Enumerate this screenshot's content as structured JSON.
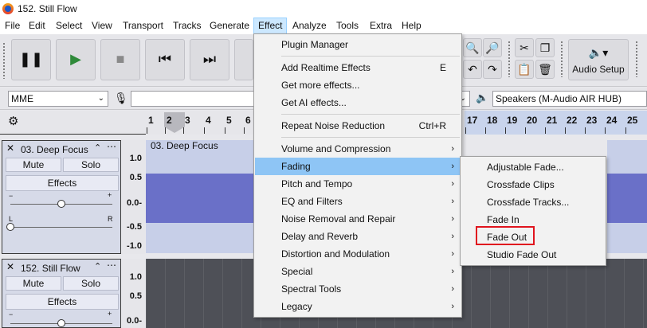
{
  "window": {
    "title": "152. Still Flow"
  },
  "menubar": {
    "items": [
      "File",
      "Edit",
      "Select",
      "View",
      "Transport",
      "Tracks",
      "Generate",
      "Effect",
      "Analyze",
      "Tools",
      "Extra",
      "Help"
    ],
    "open": "Effect"
  },
  "toolbar": {
    "audio_setup_label": "Audio Setup"
  },
  "devices": {
    "host": "MME",
    "output": "Speakers (M-Audio AIR HUB)"
  },
  "timeline": {
    "ticks": [
      "1",
      "2",
      "3",
      "4",
      "5",
      "6",
      "17",
      "18",
      "19",
      "20",
      "21",
      "22",
      "23",
      "24",
      "25"
    ]
  },
  "tracks": [
    {
      "name": "03. Deep Focus",
      "mute": "Mute",
      "solo": "Solo",
      "effects": "Effects",
      "pan_left": "L",
      "pan_right": "R",
      "clip_name": "03. Deep Focus",
      "scale": [
        "1.0",
        "0.5",
        "0.0-",
        "-0.5",
        "-1.0"
      ]
    },
    {
      "name": "152. Still Flow",
      "mute": "Mute",
      "solo": "Solo",
      "effects": "Effects",
      "scale": [
        "1.0",
        "0.5",
        "0.0-"
      ]
    }
  ],
  "effect_menu": {
    "items": [
      {
        "label": "Plugin Manager"
      },
      {
        "label": "Add Realtime Effects",
        "shortcut": "E"
      },
      {
        "label": "Get more effects..."
      },
      {
        "label": "Get AI effects..."
      },
      {
        "label": "Repeat Noise Reduction",
        "shortcut": "Ctrl+R"
      },
      {
        "label": "Volume and Compression",
        "submenu": true
      },
      {
        "label": "Fading",
        "submenu": true,
        "highlighted": true
      },
      {
        "label": "Pitch and Tempo",
        "submenu": true
      },
      {
        "label": "EQ and Filters",
        "submenu": true
      },
      {
        "label": "Noise Removal and Repair",
        "submenu": true
      },
      {
        "label": "Delay and Reverb",
        "submenu": true
      },
      {
        "label": "Distortion and Modulation",
        "submenu": true
      },
      {
        "label": "Special",
        "submenu": true
      },
      {
        "label": "Spectral Tools",
        "submenu": true
      },
      {
        "label": "Legacy",
        "submenu": true
      }
    ]
  },
  "fading_menu": {
    "items": [
      "Adjustable Fade...",
      "Crossfade Clips",
      "Crossfade Tracks...",
      "Fade In",
      "Fade Out",
      "Studio Fade Out"
    ],
    "marked": "Fade Out"
  },
  "colors": {
    "menu_highlight": "#8ec5f5",
    "marker_red": "#e0141e",
    "waveform": "#6a70c8",
    "selection_ruler": "#c9d4ec"
  },
  "icons": [
    "pause-icon",
    "play-icon",
    "stop-icon",
    "skip-start-icon",
    "skip-end-icon",
    "zoom-in-icon",
    "zoom-out-icon",
    "cut-icon",
    "copy-icon",
    "paste-icon",
    "delete-icon",
    "undo-icon",
    "audio-setup-icon",
    "microphone-icon",
    "speaker-icon",
    "gear-icon",
    "close-icon",
    "collapse-icon",
    "menu-dots-icon"
  ]
}
